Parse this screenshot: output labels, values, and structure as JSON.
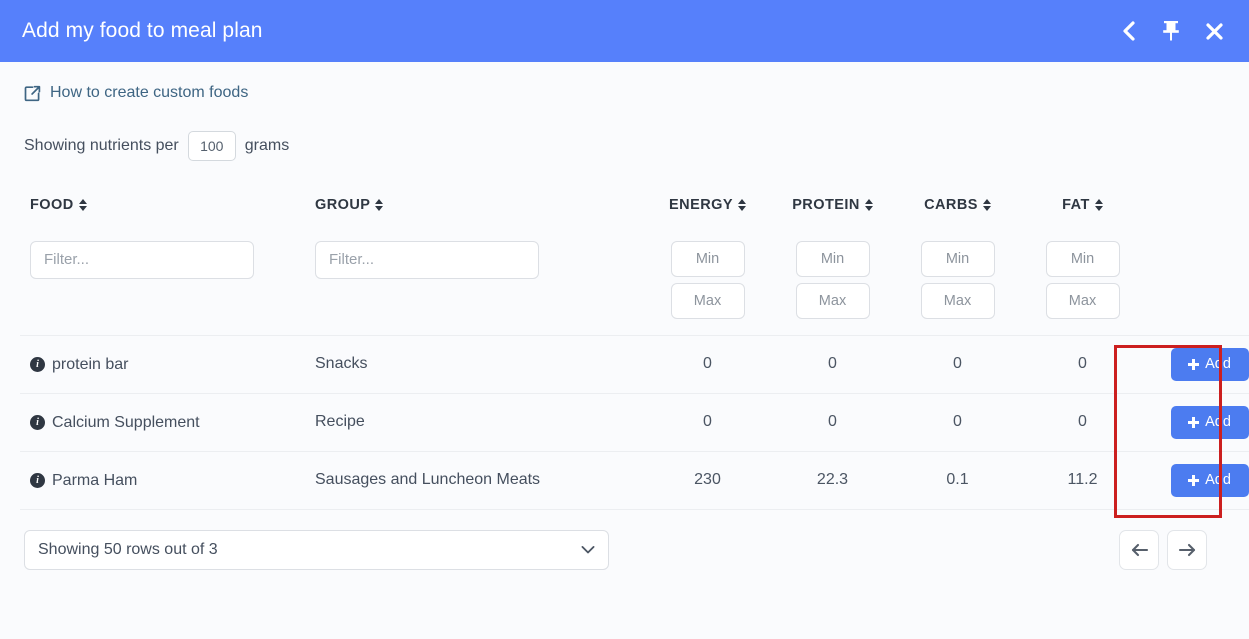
{
  "titlebar": {
    "title": "Add my food to meal plan",
    "actions": [
      {
        "name": "back-icon",
        "label": "Back"
      },
      {
        "name": "pin-icon",
        "label": "Pin"
      },
      {
        "name": "close-icon",
        "label": "Close"
      }
    ]
  },
  "howto": {
    "link_text": "How to create custom foods",
    "icon": "external-link-icon"
  },
  "per_serving": {
    "prefix": "Showing nutrients per",
    "value": "100",
    "suffix": "grams"
  },
  "table": {
    "headers": {
      "food": "FOOD",
      "group": "GROUP",
      "energy": "ENERGY",
      "protein": "PROTEIN",
      "carbs": "CARBS",
      "fat": "FAT"
    },
    "filters": {
      "food_placeholder": "Filter...",
      "group_placeholder": "Filter...",
      "min_placeholder": "Min",
      "max_placeholder": "Max",
      "food_value": "",
      "group_value": "",
      "energy_min": "",
      "energy_max": "",
      "protein_min": "",
      "protein_max": "",
      "carbs_min": "",
      "carbs_max": "",
      "fat_min": "",
      "fat_max": ""
    },
    "add_label": "Add",
    "rows": [
      {
        "food": "protein bar",
        "group": "Snacks",
        "energy": "0",
        "protein": "0",
        "carbs": "0",
        "fat": "0"
      },
      {
        "food": "Calcium Supplement",
        "group": "Recipe",
        "energy": "0",
        "protein": "0",
        "carbs": "0",
        "fat": "0"
      },
      {
        "food": "Parma Ham",
        "group": "Sausages and Luncheon Meats",
        "energy": "230",
        "protein": "22.3",
        "carbs": "0.1",
        "fat": "11.2"
      }
    ]
  },
  "footer": {
    "rows_select_value": "Showing 50 rows out of 3",
    "prev_label": "Previous page",
    "next_label": "Next page"
  },
  "annotation": {
    "color": "#cc1f1f"
  }
}
